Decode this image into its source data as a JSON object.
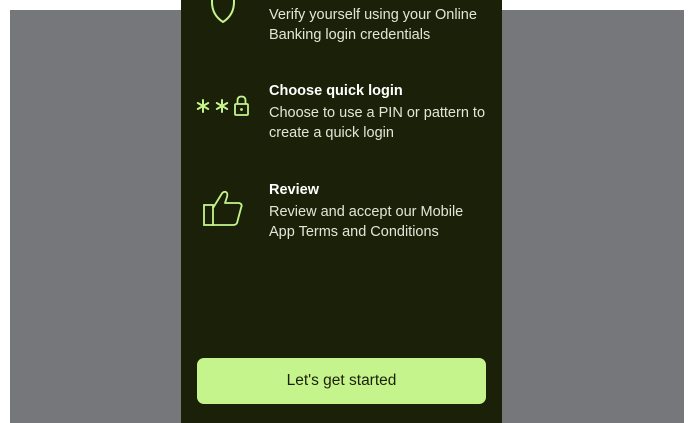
{
  "colors": {
    "backdrop": "#76777b",
    "phone_background": "#1b2009",
    "accent": "#c6f48c",
    "text_primary": "#ffffff",
    "text_secondary": "#e2e6d6"
  },
  "steps": [
    {
      "icon": "shield-icon",
      "title": "",
      "description": "Verify yourself using your Online Banking login credentials"
    },
    {
      "icon": "pin-lock-icon",
      "title": "Choose quick login",
      "description": "Choose to use a PIN or pattern to create a quick login"
    },
    {
      "icon": "thumbs-up-icon",
      "title": "Review",
      "description": "Review and accept our Mobile App Terms and Conditions"
    }
  ],
  "cta": {
    "label": "Let's get started"
  }
}
